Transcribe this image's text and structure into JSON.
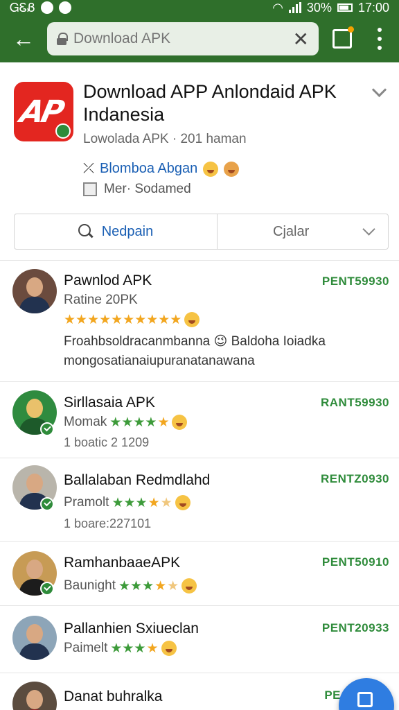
{
  "status_bar": {
    "left": "ᏀᏋᏰ",
    "battery": "30%",
    "time": "17:00"
  },
  "toolbar": {
    "back_icon": "arrow-left-icon",
    "url_placeholder": "Download APK",
    "clear_icon": "close-icon",
    "tabs_icon": "tabs-icon",
    "more_icon": "more-vert-icon"
  },
  "app": {
    "title": "Download APP Anlondaid APK Indanesia",
    "subtitle": "Lowolada APK · 201 haman",
    "developer": "Blomboa Abgan",
    "meta": "Mer· Sodamed",
    "search_label": "Nedpain",
    "filter_label": "Cjalar"
  },
  "reviews": [
    {
      "name": "Pawnlod APK",
      "code": "PENT59930",
      "rating_label": "Ratine 20PK",
      "text": "Froahbsoldracanmbanna 😉 Baldoha Ioiadka mongosatianaiupuranatanawana"
    },
    {
      "name": "Sirllasaia APK",
      "code": "RANT59930",
      "rating_label": "Momak",
      "date": "1 boatic 2 1209"
    },
    {
      "name": "Ballalaban Redmdlahd",
      "code": "RENTZ0930",
      "rating_label": "Pramolt",
      "date": "1 boare:227101"
    },
    {
      "name": "RamhanbaaeAPK",
      "code": "PENT50910",
      "rating_label": "Baunight"
    },
    {
      "name": "Pallanhien Sxiueclan",
      "code": "PENT20933",
      "rating_label": "Paimelt"
    },
    {
      "name": "Danat buhralka",
      "code": "PE"
    }
  ],
  "colors": {
    "brand_green": "#2f6f2b",
    "accent_blue": "#2f7de1",
    "code_green": "#2e8b3a"
  }
}
